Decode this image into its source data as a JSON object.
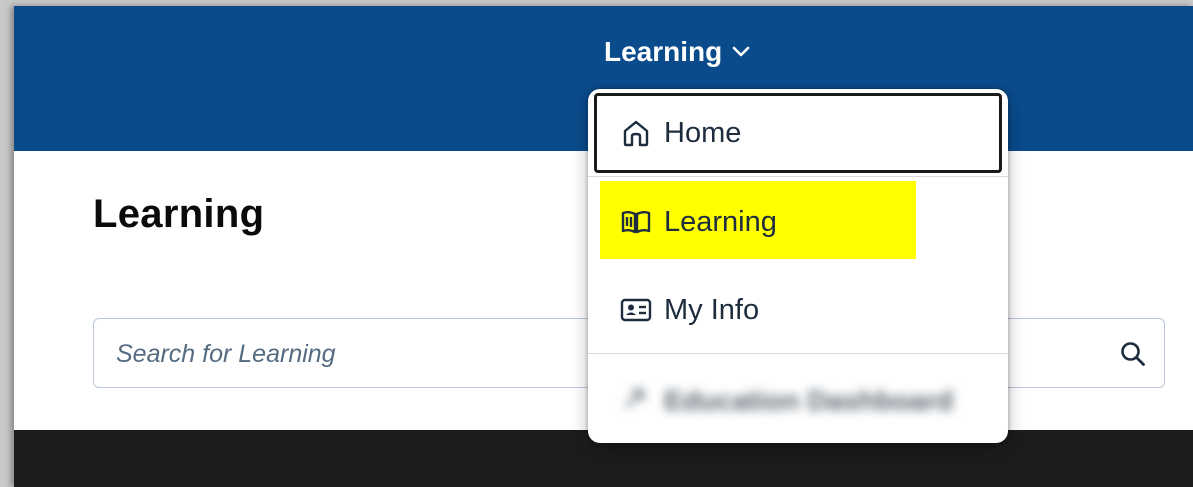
{
  "shellbar": {
    "app_title": "Learning",
    "chevron_icon": "chevron-down-icon",
    "background": "#0a4b8c"
  },
  "page": {
    "title": "Learning"
  },
  "search": {
    "placeholder": "Search for Learning",
    "icon": "search-icon"
  },
  "nav_menu": {
    "items": [
      {
        "label": "Home",
        "icon": "home-icon",
        "focused": true
      },
      {
        "label": "Learning",
        "icon": "book-icon",
        "highlighted": true,
        "highlight_color": "#ffff00"
      },
      {
        "label": "My Info",
        "icon": "id-card-icon"
      },
      {
        "label": "Education Dashboard",
        "icon": "arrow-icon",
        "blurred": true
      }
    ]
  }
}
